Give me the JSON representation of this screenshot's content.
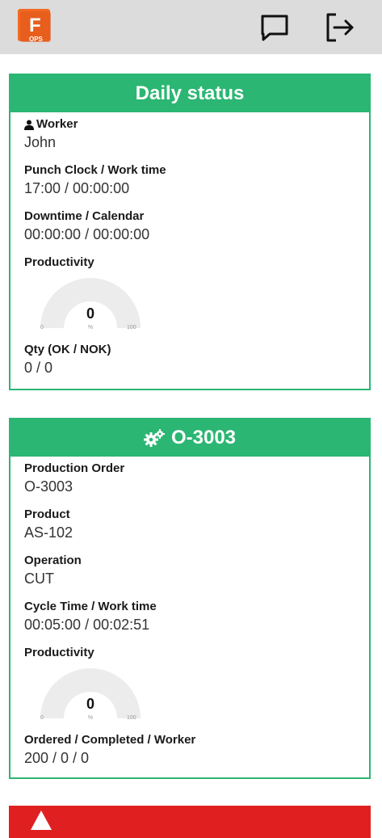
{
  "header": {
    "logo_letter": "F",
    "logo_text": "OPS",
    "icons": [
      "message-icon",
      "logout-icon"
    ]
  },
  "daily_status": {
    "title": "Daily status",
    "worker_label": "Worker",
    "worker_value": "John",
    "punch_label": "Punch Clock / Work time",
    "punch_value": "17:00 / 00:00:00",
    "downtime_label": "Downtime / Calendar",
    "downtime_value": "00:00:00 / 00:00:00",
    "productivity_label": "Productivity",
    "gauge": {
      "value": "0",
      "unit": "%",
      "min": "0",
      "max": "100"
    },
    "qty_label": "Qty (OK / NOK)",
    "qty_value": "0 / 0"
  },
  "order": {
    "title": "O-3003",
    "po_label": "Production Order",
    "po_value": "O-3003",
    "product_label": "Product",
    "product_value": "AS-102",
    "operation_label": "Operation",
    "operation_value": "CUT",
    "cycle_label": "Cycle Time / Work time",
    "cycle_value": "00:05:00 / 00:02:51",
    "productivity_label": "Productivity",
    "gauge": {
      "value": "0",
      "unit": "%",
      "min": "0",
      "max": "100"
    },
    "ordered_label": "Ordered / Completed / Worker",
    "ordered_value": "200 / 0 / 0"
  },
  "colors": {
    "accent": "#2bb673",
    "alert": "#e02020",
    "topbar": "#dcdcdc",
    "logo": "#f26a22"
  }
}
